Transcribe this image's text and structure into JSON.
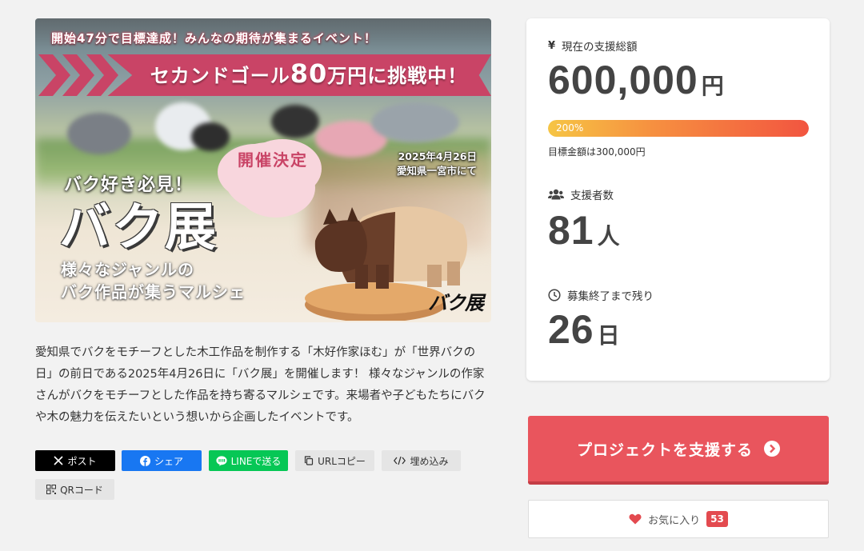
{
  "hero": {
    "tagline": "開始47分で目標達成！みんなの期待が集まるイベント！",
    "banner_pre": "セカンドゴール",
    "banner_big": "80",
    "banner_post": "万円に挑戦中！",
    "bubble": "開催決定",
    "date_line1": "2025年4月26日",
    "date_line2": "愛知県一宮市にて",
    "must_see": "バク好き必見！",
    "title": "バク展",
    "subtitle_line1": "様々なジャンルの",
    "subtitle_line2": "バク作品が集うマルシェ",
    "logo": "バク展"
  },
  "description": "愛知県でバクをモチーフとした木工作品を制作する「木好作家ほむ」が「世界バクの日」の前日である2025年4月26日に「バク展」を開催します！ 様々なジャンルの作家さんがバクをモチーフとした作品を持ち寄るマルシェです。来場者や子どもたちにバクや木の魅力を伝えたいという想いから企画したイベントです。",
  "share": {
    "post": "ポスト",
    "facebook": "シェア",
    "line": "LINEで送る",
    "url_copy": "URLコピー",
    "embed": "埋め込み",
    "qr": "QRコード"
  },
  "stats": {
    "total_label": "現在の支援総額",
    "total_value": "600,000",
    "total_unit": "円",
    "progress_text": "200%",
    "progress_fraction": 1.0,
    "target_text": "目標金額は300,000円",
    "supporters_label": "支援者数",
    "supporters_value": "81",
    "supporters_unit": "人",
    "remaining_label": "募集終了まで残り",
    "remaining_value": "26",
    "remaining_unit": "日"
  },
  "actions": {
    "support_label": "プロジェクトを支援する",
    "favorite_label": "お気に入り",
    "favorite_count": "53"
  },
  "colors": {
    "accent_red": "#e9555d",
    "banner_pink": "#c94466",
    "line_green": "#06c755",
    "facebook_blue": "#1877f2"
  }
}
